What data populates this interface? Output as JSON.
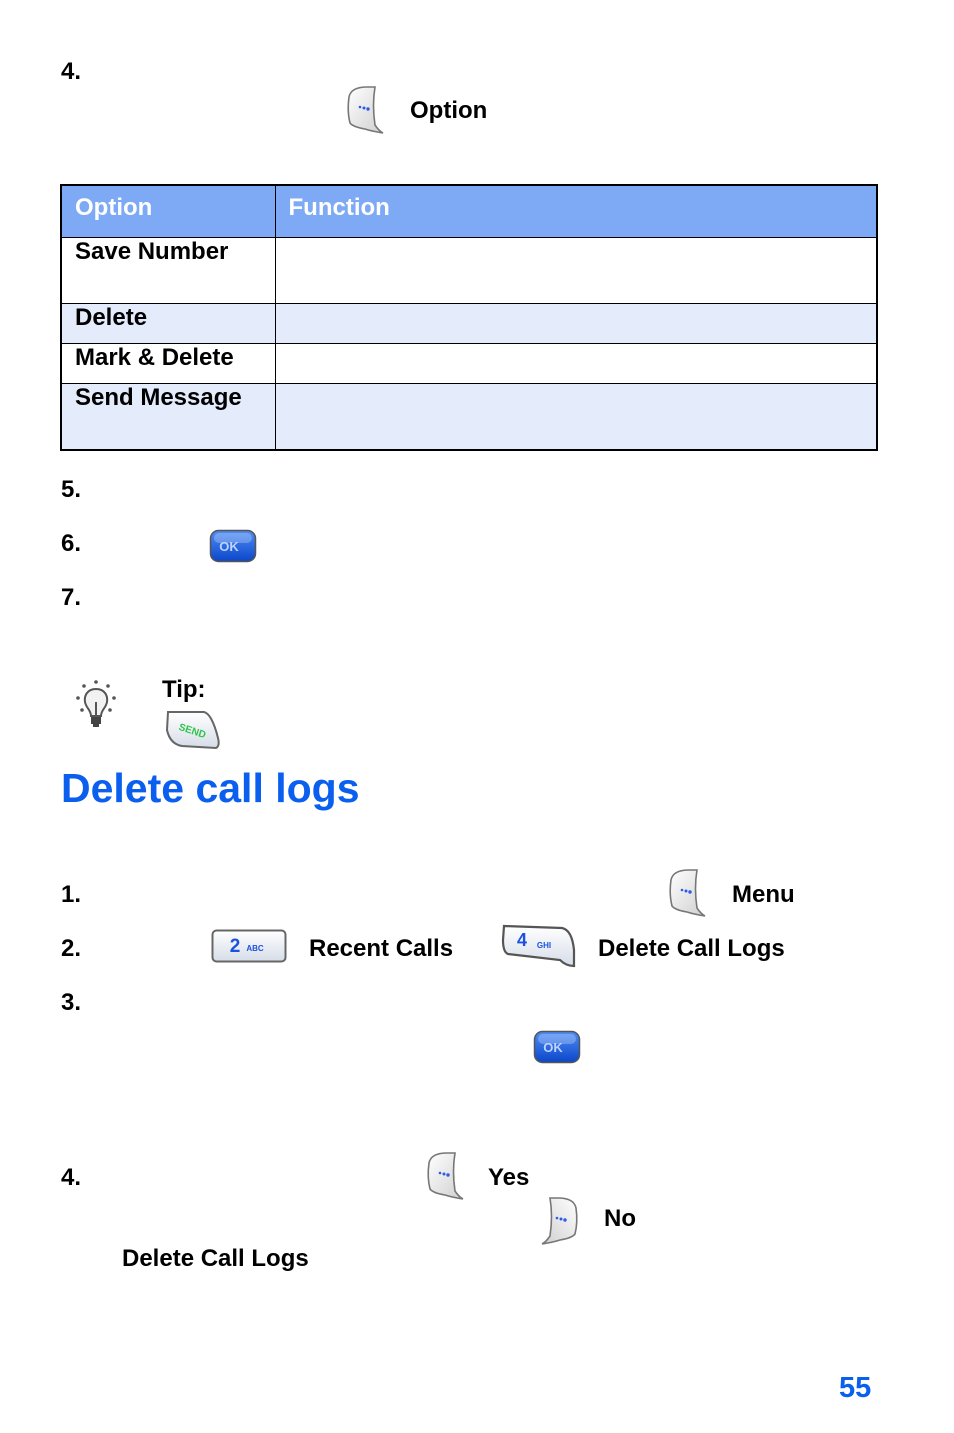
{
  "section_top": {
    "step4_number": "4.",
    "step4_key_label": "Option",
    "step4_key_icon": "left-soft-key-icon"
  },
  "options_table": {
    "headers": [
      "Option",
      "Function"
    ],
    "rows": [
      {
        "option": "Save Number",
        "function": ""
      },
      {
        "option": "Delete",
        "function": ""
      },
      {
        "option": "Mark & Delete",
        "function": ""
      },
      {
        "option": "Send Message",
        "function": ""
      }
    ],
    "colors": {
      "header_bg": "#7eaaf5",
      "header_text": "#ffffff",
      "shaded_row": "#e4ebfb"
    }
  },
  "steps_after_table": [
    {
      "number": "5."
    },
    {
      "number": "6.",
      "key_icon": "ok-key-icon",
      "key_label": "OK"
    },
    {
      "number": "7."
    }
  ],
  "tip": {
    "label": "Tip:",
    "icon": "lightbulb-icon",
    "key_icon": "send-key-icon",
    "key_label": "SEND"
  },
  "delete_section": {
    "title": "Delete call logs",
    "title_color": "#0a5fee",
    "steps": [
      {
        "number": "1.",
        "key_icon": "left-soft-key-icon",
        "key_label": "Menu"
      },
      {
        "number": "2.",
        "key1_icon": "2-abc-key-icon",
        "key1_text": "2",
        "key1_sub": "ABC",
        "label1": "Recent Calls",
        "key2_icon": "4-ghi-key-icon",
        "key2_text": "4",
        "key2_sub": "GHI",
        "label2": "Delete Call Logs"
      },
      {
        "number": "3.",
        "key_icon": "ok-key-icon",
        "key_label": "OK"
      },
      {
        "number": "4.",
        "key1_icon": "left-soft-key-icon",
        "label1": "Yes",
        "key2_icon": "right-soft-key-icon",
        "label2": "No",
        "trailing": "Delete Call Logs"
      }
    ]
  },
  "page_number": "55"
}
